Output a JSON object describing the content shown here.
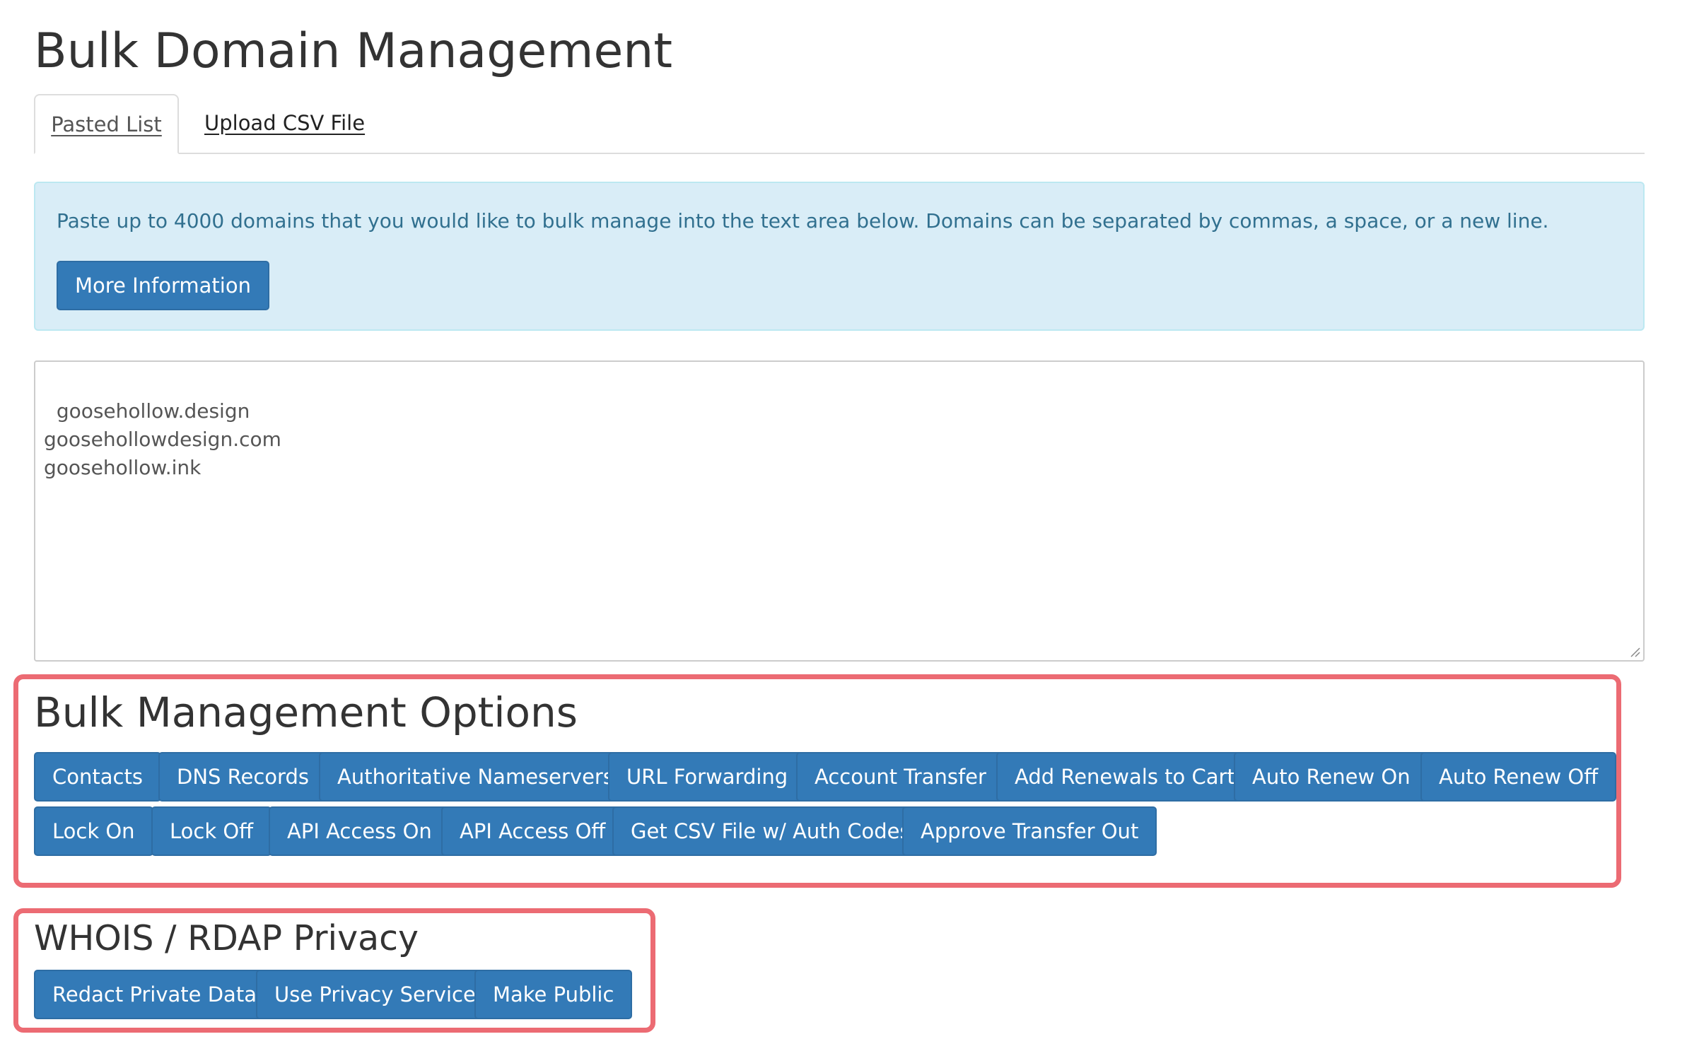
{
  "page": {
    "title": "Bulk Domain Management"
  },
  "tabs": [
    {
      "label": "Pasted List",
      "active": true
    },
    {
      "label": "Upload CSV File",
      "active": false
    }
  ],
  "info": {
    "text": "Paste up to 4000 domains that you would like to bulk manage into the text area below. Domains can be separated by commas, a space, or a new line.",
    "more_info_label": "More Information"
  },
  "domains": {
    "value": "goosehollow.design\ngoosehollowdesign.com\ngoosehollow.ink"
  },
  "bulk_options": {
    "heading": "Bulk Management Options",
    "buttons": [
      "Contacts",
      "DNS Records",
      "Authoritative Nameservers",
      "URL Forwarding",
      "Account Transfer",
      "Add Renewals to Cart",
      "Auto Renew On",
      "Auto Renew Off",
      "Lock On",
      "Lock Off",
      "API Access On",
      "API Access Off",
      "Get CSV File w/ Auth Codes",
      "Approve Transfer Out"
    ]
  },
  "whois": {
    "heading": "WHOIS / RDAP Privacy",
    "buttons": [
      "Redact Private Data",
      "Use Privacy Service",
      "Make Public"
    ]
  },
  "colors": {
    "primary": "#337ab7",
    "primary_border": "#2e6da4",
    "alert_bg": "#d9edf7",
    "alert_text": "#31708f",
    "highlight": "#ec6b73"
  },
  "icons": {
    "textarea_resize": "resize-grip-icon"
  }
}
